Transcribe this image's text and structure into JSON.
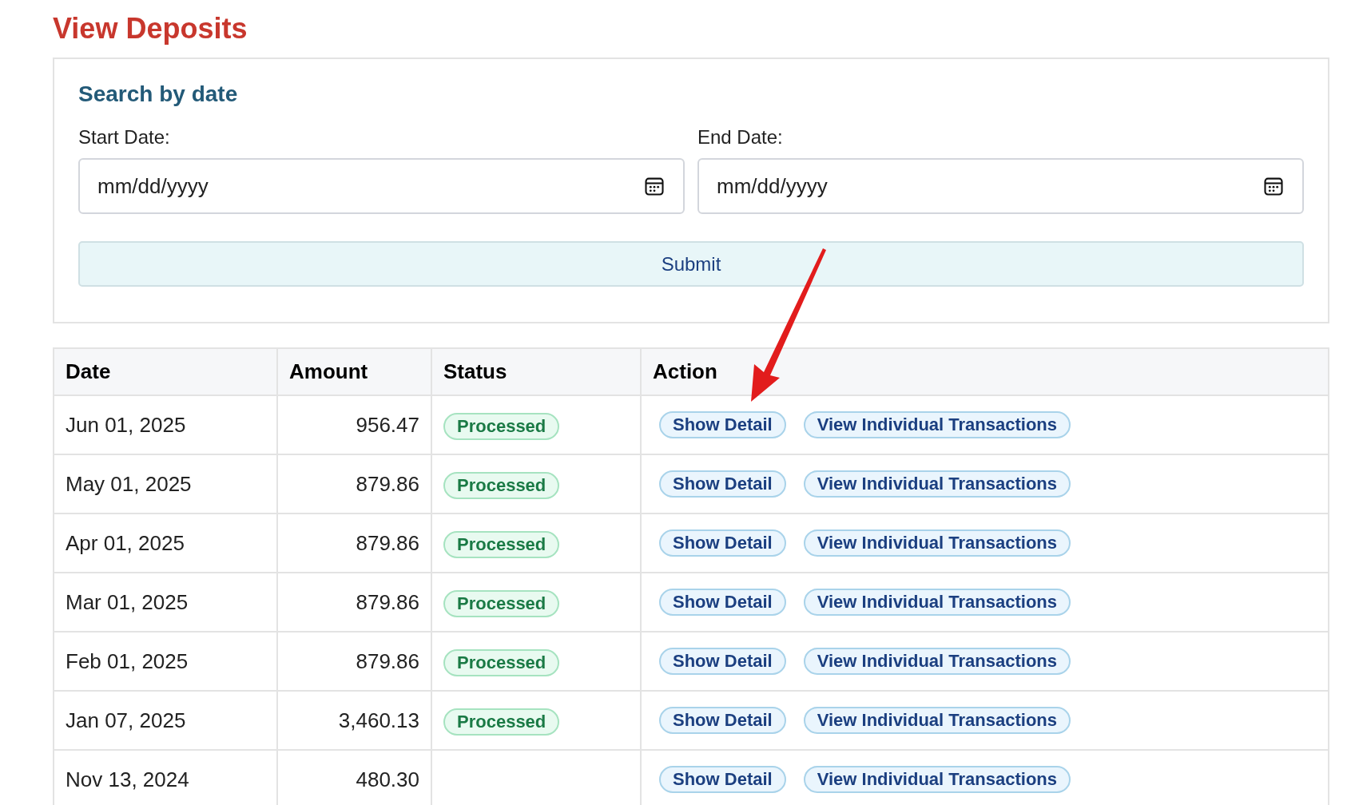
{
  "title": "View Deposits",
  "search": {
    "heading": "Search by date",
    "fields": [
      {
        "label": "Start Date:",
        "placeholder": "mm/dd/yyyy"
      },
      {
        "label": "End Date:",
        "placeholder": "mm/dd/yyyy"
      }
    ],
    "submit": "Submit"
  },
  "table": {
    "columns": [
      "Date",
      "Amount",
      "Status",
      "Action"
    ],
    "rows": [
      {
        "date": "Jun 01, 2025",
        "amount": "956.47",
        "status": "Processed",
        "actions": [
          "Show Detail",
          "View Individual Transactions"
        ]
      },
      {
        "date": "May 01, 2025",
        "amount": "879.86",
        "status": "Processed",
        "actions": [
          "Show Detail",
          "View Individual Transactions"
        ]
      },
      {
        "date": "Apr 01, 2025",
        "amount": "879.86",
        "status": "Processed",
        "actions": [
          "Show Detail",
          "View Individual Transactions"
        ]
      },
      {
        "date": "Mar 01, 2025",
        "amount": "879.86",
        "status": "Processed",
        "actions": [
          "Show Detail",
          "View Individual Transactions"
        ]
      },
      {
        "date": "Feb 01, 2025",
        "amount": "879.86",
        "status": "Processed",
        "actions": [
          "Show Detail",
          "View Individual Transactions"
        ]
      },
      {
        "date": "Jan 07, 2025",
        "amount": "3,460.13",
        "status": "Processed",
        "actions": [
          "Show Detail",
          "View Individual Transactions"
        ]
      },
      {
        "date": "Nov 13, 2024",
        "amount": "480.30",
        "actions": [
          "Show Detail",
          "View Individual Transactions"
        ]
      }
    ]
  }
}
